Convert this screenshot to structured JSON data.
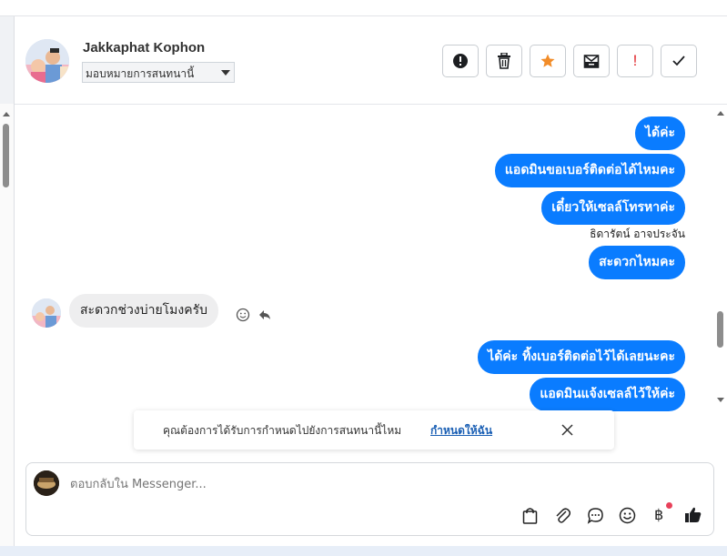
{
  "header": {
    "contact_name": "Jakkaphat Kophon",
    "assign_label": "มอบหมายการสนทนานี้",
    "toolbar": [
      {
        "icon": "alert-circle-icon",
        "label": "!"
      },
      {
        "icon": "trash-icon"
      },
      {
        "icon": "star-icon"
      },
      {
        "icon": "archive-mail-icon"
      },
      {
        "icon": "exclamation-icon",
        "label": "!"
      },
      {
        "icon": "check-icon"
      }
    ]
  },
  "messages": {
    "out1": "ได้ค่ะ",
    "out2": "แอดมินขอเบอร์ติดต่อได้ไหมคะ",
    "out3": "เดี๋ยวให้เซลล์โทรหาค่ะ",
    "sender_name": "ธิดารัตน์ อาจประจัน",
    "out4": "สะดวกไหมคะ",
    "in1": "สะดวกช่วงบ่ายโมงครับ",
    "out5": "ได้ค่ะ ทิ้งเบอร์ติดต่อไว้ได้เลยนะคะ",
    "out6": "แอดมินแจ้งเซลล์ไว้ให้ค่ะ"
  },
  "notice": {
    "text": "คุณต้องการได้รับการกำหนดไปยังการสนทนานี้ไหม",
    "link": "กำหนดให้ฉัน"
  },
  "composer": {
    "placeholder": "ตอบกลับใน Messenger...",
    "currency_symbol": "฿"
  },
  "colors": {
    "outgoing_bubble": "#0a7cff",
    "incoming_bubble": "#eeeeef",
    "star": "#f28c28",
    "alert_red": "#e0262b",
    "badge_dot": "#e8415a"
  }
}
